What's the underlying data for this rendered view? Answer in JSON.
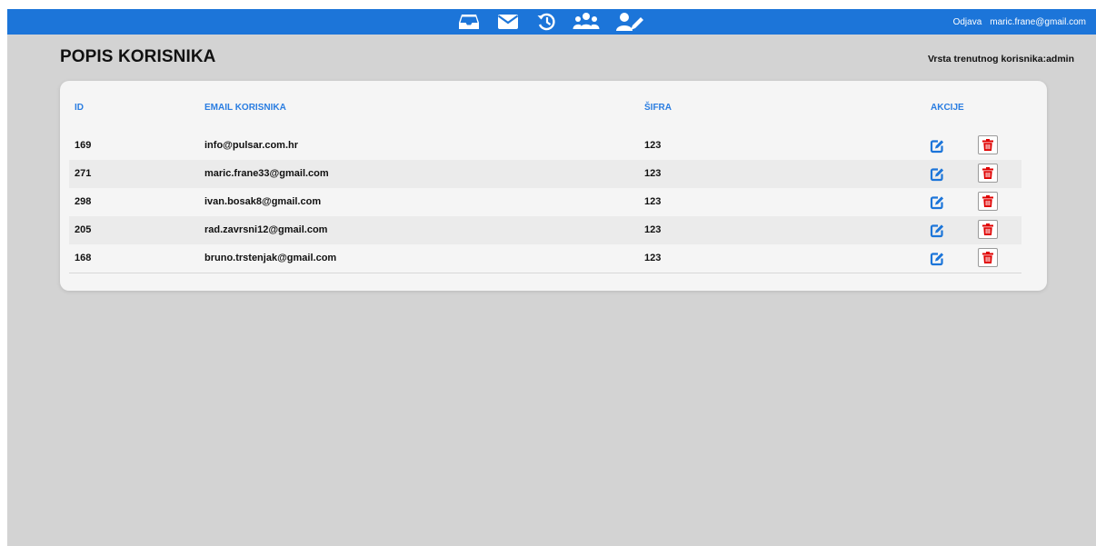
{
  "topbar": {
    "icons": [
      "inbox-icon",
      "mail-icon",
      "history-icon",
      "users-icon",
      "user-edit-icon"
    ],
    "logout_label": "Odjava",
    "user_email": "maric.frane@gmail.com"
  },
  "page": {
    "title": "POPIS KORISNIKA",
    "role_text": "Vrsta trenutnog korisnika:admin"
  },
  "table": {
    "headers": {
      "id": "ID",
      "email": "EMAIL KORISNIKA",
      "password": "ŠIFRA",
      "actions": "AKCIJE"
    },
    "rows": [
      {
        "id": "169",
        "email": "info@pulsar.com.hr",
        "password": "123"
      },
      {
        "id": "271",
        "email": "maric.frane33@gmail.com",
        "password": "123"
      },
      {
        "id": "298",
        "email": "ivan.bosak8@gmail.com",
        "password": "123"
      },
      {
        "id": "205",
        "email": "rad.zavrsni12@gmail.com",
        "password": "123"
      },
      {
        "id": "168",
        "email": "bruno.trstenjak@gmail.com",
        "password": "123"
      }
    ],
    "action_icons": [
      "edit-icon",
      "trash-icon"
    ]
  },
  "colors": {
    "topbar": "#1c75d9",
    "background": "#d3d3d3",
    "header_text": "#2a7de1",
    "edit_icon": "#1c75d9",
    "delete_icon": "#e00000"
  }
}
